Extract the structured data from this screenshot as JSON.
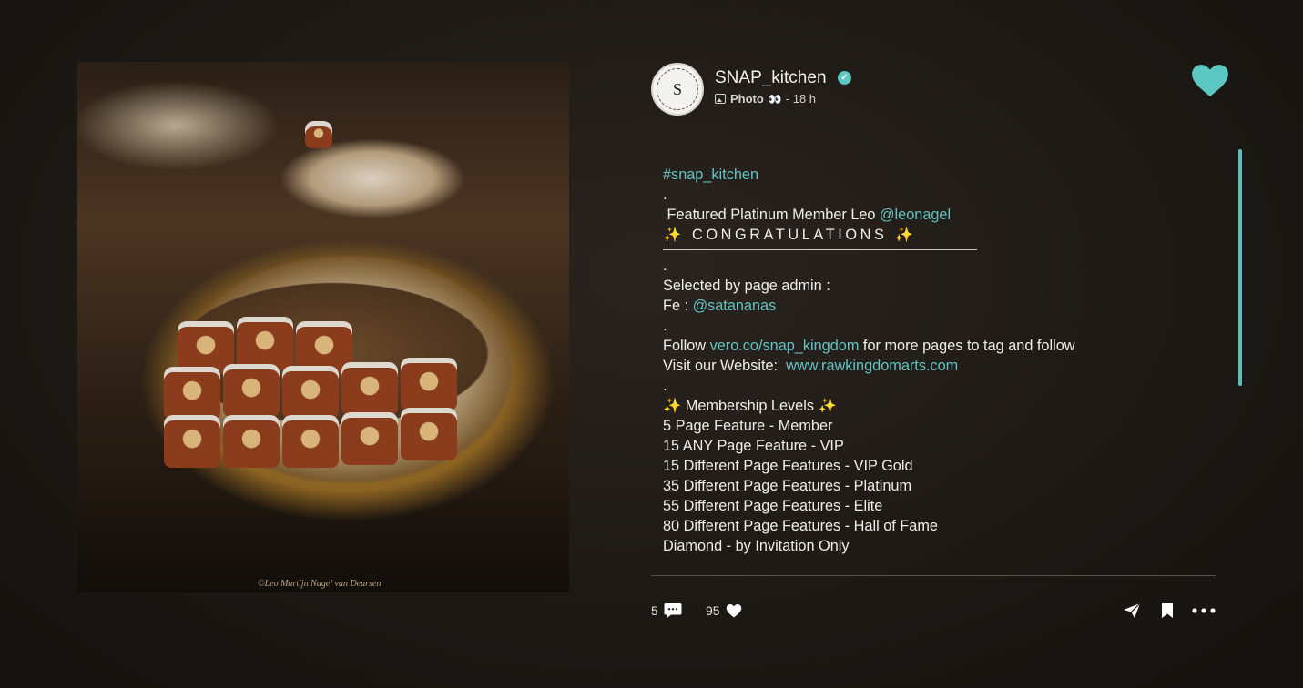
{
  "post": {
    "photo_credit": "©Leo Martijn Nagel van Deursen",
    "avatar_monogram": "S",
    "username": "SNAP_kitchen",
    "verified_mark": "✓",
    "type": "Photo",
    "binoculars": "👀",
    "time": "- 18 h"
  },
  "caption": {
    "hashtag": "#snap_kitchen",
    "dot1": ".",
    "featured_prefix": " Featured Platinum Member Leo ",
    "featured_mention": "@leonagel",
    "congrats": "✨ CONGRATULATIONS ✨",
    "dot2": ".",
    "selected_by": "Selected by page admin :",
    "fe_prefix": "Fe : ",
    "fe_mention": "@satananas",
    "dot3": ".",
    "follow_prefix": "Follow ",
    "follow_link": "vero.co/snap_kingdom",
    "follow_suffix": " for more pages to tag and follow",
    "visit_prefix": "Visit our Website:  ",
    "visit_link": "www.rawkingdomarts.com",
    "dot4": ".",
    "levels_title": "✨ Membership Levels ✨",
    "levels": [
      "5 Page Feature - Member",
      "15 ANY Page Feature - VIP",
      "15 Different Page Features - VIP Gold",
      "35 Different Page Features - Platinum",
      "55 Different Page Features - Elite",
      "80 Different Page Features - Hall of Fame",
      "Diamond - by Invitation Only"
    ]
  },
  "footer": {
    "comments_count": "5",
    "likes_count": "95"
  },
  "icons": {
    "heart": "heart-icon",
    "comment": "comment-icon",
    "send": "send-icon",
    "bookmark": "bookmark-icon",
    "more": "more-icon"
  },
  "colors": {
    "accent": "#5bc8c3",
    "link": "#62c3c0",
    "background": "#1d1915"
  }
}
